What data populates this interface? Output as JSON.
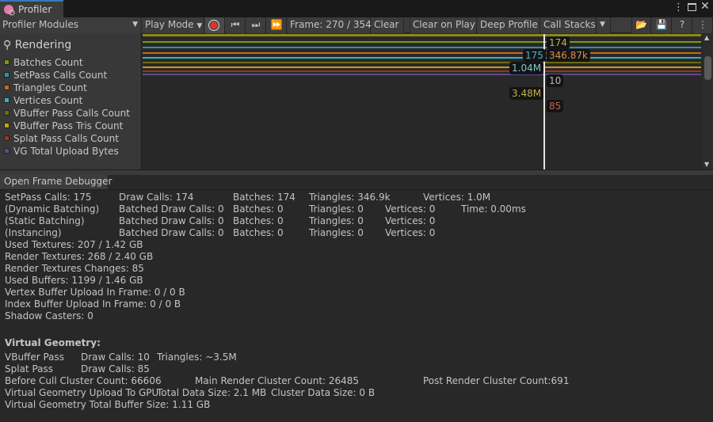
{
  "window": {
    "title": "Profiler"
  },
  "toolbar": {
    "modules": "Profiler Modules",
    "play_mode": "Play Mode",
    "frame": "Frame: 270 / 354",
    "clear": "Clear",
    "clear_on_play": "Clear on Play",
    "deep_profile": "Deep Profile",
    "call_stacks": "Call Stacks"
  },
  "module": {
    "title": "Rendering",
    "legend": [
      {
        "label": "Batches Count",
        "color": "#7a9a10"
      },
      {
        "label": "SetPass Calls Count",
        "color": "#2f8fb5"
      },
      {
        "label": "Triangles Count",
        "color": "#c7681a"
      },
      {
        "label": "Vertices Count",
        "color": "#3ab0c0"
      },
      {
        "label": "VBuffer Pass Calls Count",
        "color": "#6b6b14"
      },
      {
        "label": "VBuffer Pass Tris Count",
        "color": "#c4a012"
      },
      {
        "label": "Splat Pass Calls Count",
        "color": "#a0320f"
      },
      {
        "label": "VG Total Upload Bytes",
        "color": "#5e4a8c"
      }
    ]
  },
  "graph": {
    "cursor_labels": [
      "174",
      "175",
      "346.87k",
      "1.04M",
      "10",
      "3.48M",
      "85"
    ]
  },
  "details": {
    "open_frame_debugger": "Open Frame Debugger",
    "rows": [
      [
        "SetPass Calls: 175",
        "Draw Calls: 174",
        "Batches: 174",
        "Triangles: 346.9k",
        "",
        "Vertices: 1.0M",
        ""
      ],
      [
        "(Dynamic Batching)",
        "Batched Draw Calls: 0",
        "Batches: 0",
        "Triangles: 0",
        "Vertices: 0",
        "",
        "Time: 0.00ms"
      ],
      [
        "(Static Batching)",
        "Batched Draw Calls: 0",
        "Batches: 0",
        "Triangles: 0",
        "Vertices: 0",
        "",
        ""
      ],
      [
        "(Instancing)",
        "Batched Draw Calls: 0",
        "Batches: 0",
        "Triangles: 0",
        "Vertices: 0",
        "",
        ""
      ]
    ],
    "lines": [
      "Used Textures: 207 / 1.42 GB",
      "Render Textures: 268 / 2.40 GB",
      "Render Textures Changes: 85",
      "Used Buffers: 1199 / 1.46 GB",
      "Vertex Buffer Upload In Frame: 0 / 0 B",
      "Index Buffer Upload In Frame: 0 / 0 B",
      "Shadow Casters: 0"
    ],
    "vg_title": "Virtual Geometry:",
    "vg": {
      "vbuffer": [
        "VBuffer Pass",
        "Draw Calls: 10",
        "Triangles: ~3.5M"
      ],
      "splat": [
        "Splat Pass",
        "Draw Calls: 85"
      ],
      "cull": [
        "Before Cull Cluster Count: 66606",
        "Main Render Cluster Count: 26485",
        "Post Render Cluster Count:691"
      ],
      "upload": [
        "Virtual Geometry Upload To GPU",
        "Total Data Size: 2.1 MB",
        "Cluster Data Size: 0 B"
      ],
      "total": "Virtual Geometry Total Buffer Size: 1.11 GB"
    }
  }
}
